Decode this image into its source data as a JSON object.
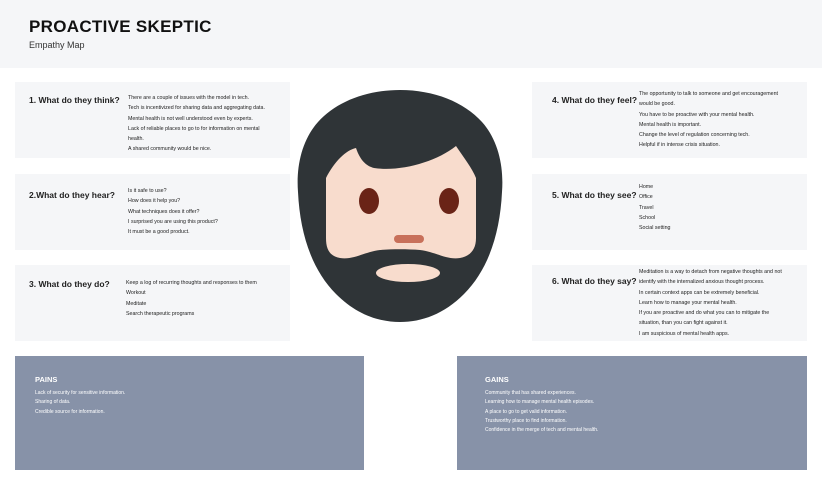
{
  "header": {
    "title": "PROACTIVE SKEPTIC",
    "subtitle": "Empathy Map"
  },
  "cards": {
    "think": {
      "question": "1. What do they think?",
      "answers": [
        "There are a couple of issues with the model in tech.",
        "Tech is incentivized for sharing data and aggregating data.",
        "Mental health is not well understood even by experts.",
        "Lack of reliable places to go to for information on mental",
        "health.",
        "A shared community would be nice."
      ]
    },
    "hear": {
      "question": "2.What do they hear?",
      "answers": [
        "Is it safe to use?",
        "How does it help you?",
        "What techniques does it offer?",
        "I surprised you are using this product?",
        "It must be a good product."
      ]
    },
    "do": {
      "question": "3. What do they do?",
      "answers": [
        "Keep a log of recurring thoughts and responses to them",
        "Workout",
        "Meditate",
        "Search therapeutic programs"
      ]
    },
    "feel": {
      "question": "4. What do they feel?",
      "answers": [
        "The opportunity to talk to someone and get encouragement",
        "would be good.",
        "You have to be proactive with your mental health.",
        "Mental health is important.",
        "Change the level of regulation concerning tech.",
        "Helpful if in intense crisis situation."
      ]
    },
    "see": {
      "question": "5. What do they see?",
      "answers": [
        "Home",
        "Office",
        "Travel",
        "School",
        "Social setting"
      ]
    },
    "say": {
      "question": "6. What do they say?",
      "answers": [
        "Meditation is a way to detach from negative thoughts and not",
        "identify with the internalized anxious thought process.",
        "In certain context apps can be extremely beneficial.",
        "Learn how to manage your mental health.",
        "If you are proactive and do what you can to mitigate the",
        "situation, than you can fight against it.",
        "I am suspicious of mental health apps."
      ]
    }
  },
  "pains": {
    "title": "PAINS",
    "items": [
      "Lack of security for sensitive information.",
      "Sharing of data.",
      "Credible source for information."
    ]
  },
  "gains": {
    "title": "GAINS",
    "items": [
      "Community that has shared experiences.",
      "Learning how to manage mental health episodes.",
      "A place to go to get valid information.",
      "Trustworthy place to find information.",
      "Confidence in the merge of tech and mental health."
    ]
  },
  "colors": {
    "card_bg": "#f5f6f8",
    "band_bg": "#8792a8",
    "hair": "#2f3437",
    "skin": "#f8dccd",
    "eyes": "#6a2417",
    "mouth": "#c8705a"
  },
  "illustration": "bearded-face-icon"
}
